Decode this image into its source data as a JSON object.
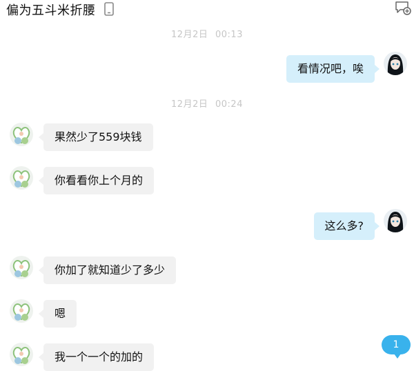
{
  "header": {
    "title": "偏为五斗米折腰",
    "phone_icon": "phone-icon",
    "compose_icon": "compose-icon"
  },
  "timestamps": [
    {
      "date": "12月2日",
      "time": "00:13"
    },
    {
      "date": "12月2日",
      "time": "00:24"
    }
  ],
  "messages": [
    {
      "direction": "out",
      "text": "看情况吧，唉"
    },
    {
      "direction": "in",
      "text": "果然少了559块钱"
    },
    {
      "direction": "in",
      "text": "你看看你上个月的"
    },
    {
      "direction": "out",
      "text": "这么多?"
    },
    {
      "direction": "in",
      "text": "你加了就知道少了多少"
    },
    {
      "direction": "in",
      "text": "嗯"
    },
    {
      "direction": "in",
      "text": "我一个一个的加的"
    }
  ],
  "unread_badge": {
    "count": "1"
  },
  "colors": {
    "incoming_bubble": "#f1f1f1",
    "outgoing_bubble": "#d5effb",
    "timestamp": "#c6c6c6",
    "badge": "#39b2ec"
  }
}
